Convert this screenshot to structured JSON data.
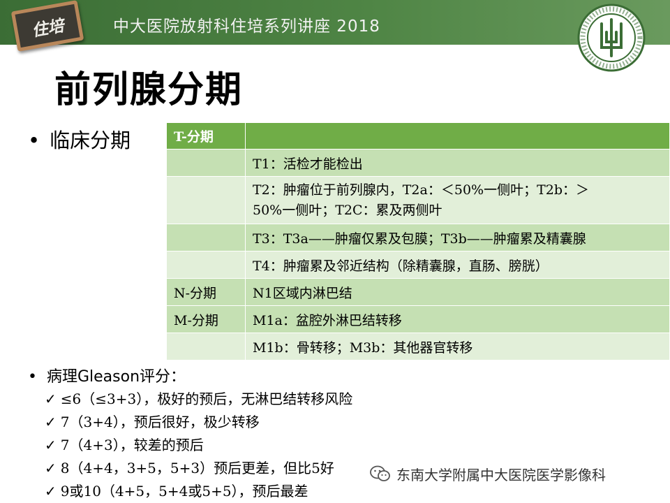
{
  "header": {
    "badge_text": "住培",
    "title": "中大医院放射科住培系列讲座 2018",
    "accent_color": "#4f8545",
    "logo_icon": "hospital-seal-icon"
  },
  "slide": {
    "title": "前列腺分期",
    "bullet_clinical": "临床分期",
    "table": {
      "header_color": "#70ad47",
      "rows": [
        {
          "c1": "T-分期",
          "c2": ""
        },
        {
          "c1": "",
          "c2": "T1：活检才能检出"
        },
        {
          "c1": "",
          "c2": "T2：肿瘤位于前列腺内，T2a：＜50%一侧叶；T2b：＞",
          "c2b": "50%一侧叶；T2C：累及两侧叶"
        },
        {
          "c1": "",
          "c2": "T3：T3a——肿瘤仅累及包膜；T3b——肿瘤累及精囊腺"
        },
        {
          "c1": "",
          "c2": "T4：肿瘤累及邻近结构（除精囊腺，直肠、膀胱）"
        },
        {
          "c1": "N-分期",
          "c2": "N1区域内淋巴结"
        },
        {
          "c1": "M-分期",
          "c2": "M1a：盆腔外淋巴结转移"
        },
        {
          "c1": "",
          "c2": "M1b：骨转移；M3b：其他器官转移"
        }
      ]
    },
    "bullet_pathology": "病理Gleason评分：",
    "gleason": [
      "≤6（≤3+3），极好的预后，无淋巴结转移风险",
      "7（3+4），预后很好，极少转移",
      "7（4+3），较差的预后",
      "8（4+4，3+5，5+3）预后更差，但比5好",
      "9或10（4+5，5+4或5+5），预后最差"
    ]
  },
  "watermark": {
    "text": "东南大学附属中大医院医学影像科",
    "icon": "wechat-icon"
  }
}
